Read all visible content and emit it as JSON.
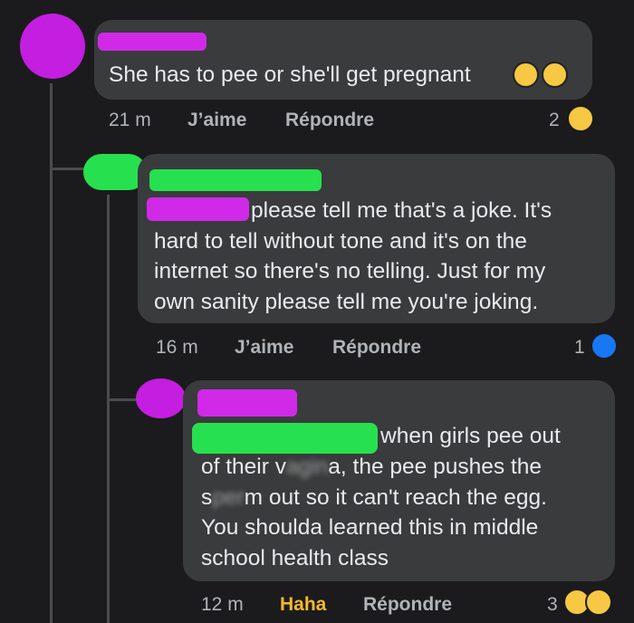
{
  "colors": {
    "background": "#1b1b1d",
    "bubble": "#3a3b3c",
    "redact_purple": "#d02ae8",
    "redact_green": "#27e04f",
    "reaction_like": "#1877f2",
    "reaction_haha": "#f7b928"
  },
  "comments": [
    {
      "text_lines": [
        "She has to pee or she'll get pregnant"
      ],
      "emoji_icons": [
        "laughing-tears-icon",
        "laughing-tears-icon"
      ],
      "time": "21 m",
      "like_label": "J’aime",
      "reply_label": "Répondre",
      "reaction_count": "2",
      "reaction_icons": [
        "haha-reaction-icon"
      ]
    },
    {
      "text_lines": [
        "please tell me that's a joke. It's",
        "hard to tell without tone and it's on the",
        "internet so there's no telling. Just for my",
        "own sanity please tell me you're joking."
      ],
      "time": "16 m",
      "like_label": "J’aime",
      "reply_label": "Répondre",
      "reaction_count": "1",
      "reaction_icons": [
        "like-reaction-icon"
      ]
    },
    {
      "line1": "when girls pee out",
      "line2_a": "of their v",
      "line2_censored": "agin",
      "line2_b": "a, the pee pushes the",
      "line3_a": "s",
      "line3_censored": "per",
      "line3_b": "m out so it can't reach the egg.",
      "line4": "You shoulda learned this in middle",
      "line5": "school health class",
      "time": "12 m",
      "haha_label": "Haha",
      "reply_label": "Répondre",
      "reaction_count": "3",
      "reaction_icons": [
        "haha-reaction-icon",
        "sad-reaction-icon"
      ]
    }
  ]
}
